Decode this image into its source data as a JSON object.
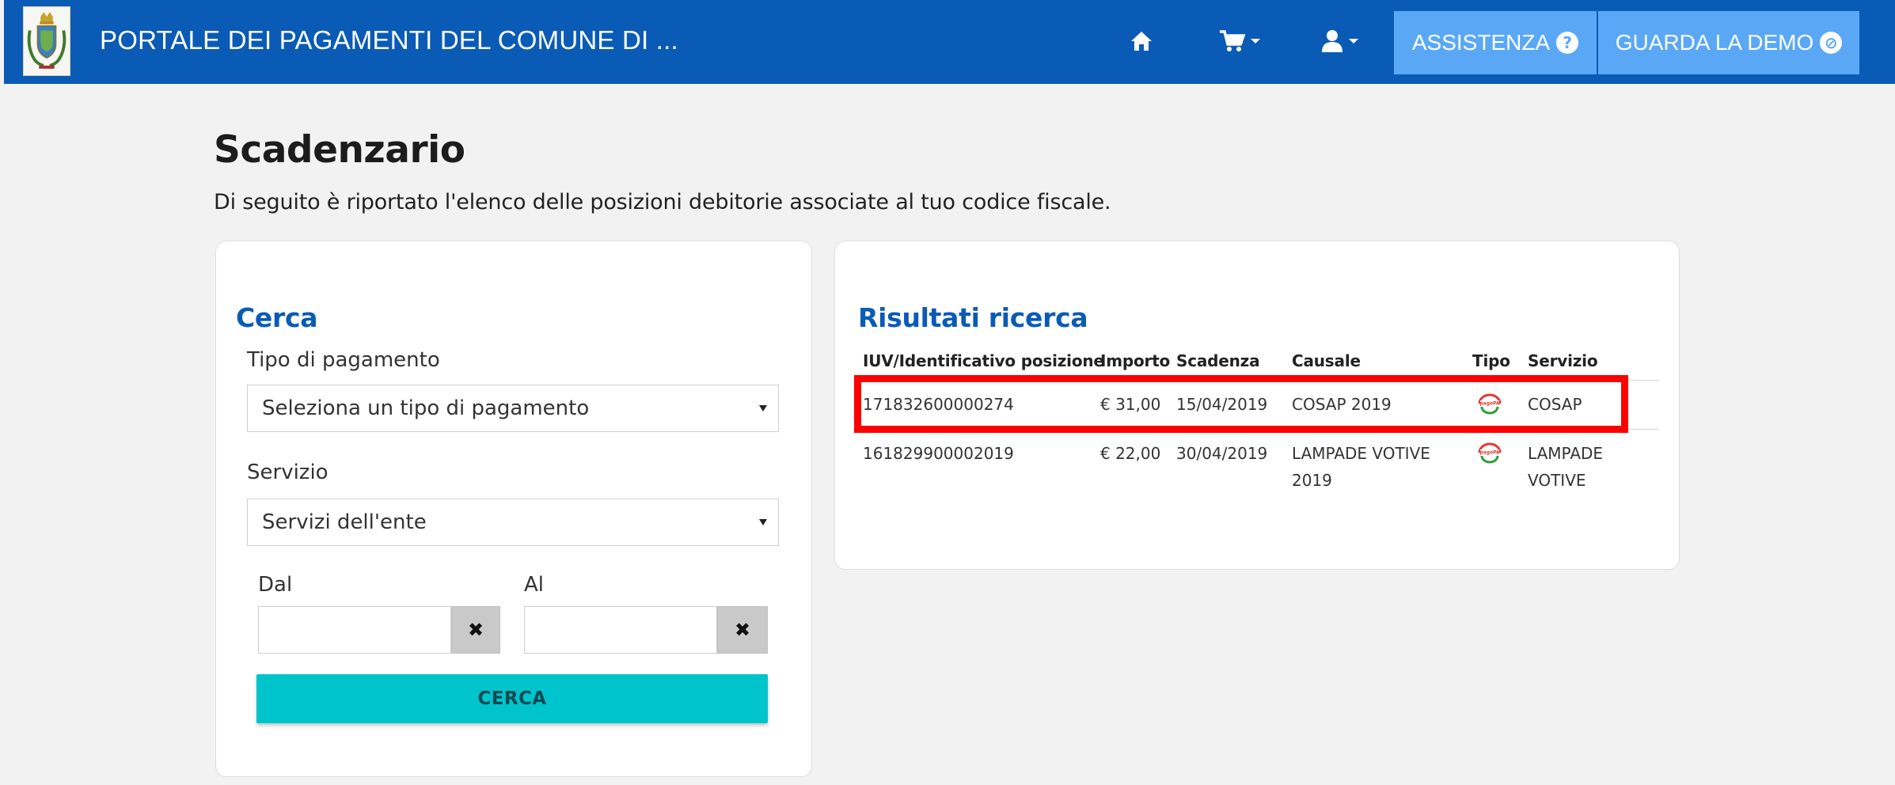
{
  "navbar": {
    "brand": "PORTALE DEI PAGAMENTI DEL COMUNE DI ...",
    "icons": {
      "home": "home-icon",
      "cart": "cart-icon",
      "user": "user-icon"
    },
    "assistenza_label": "ASSISTENZA",
    "assistenza_icon": "?",
    "demo_label": "GUARDA LA DEMO",
    "demo_icon": "⊘",
    "colors": {
      "bar": "#0a5bb5",
      "button": "#5aa8f5"
    }
  },
  "page": {
    "title": "Scadenzario",
    "subtitle": "Di seguito è riportato l'elenco delle posizioni debitorie associate al tuo codice fiscale."
  },
  "search": {
    "heading": "Cerca",
    "tipo_label": "Tipo di pagamento",
    "tipo_value": "Seleziona un tipo di pagamento",
    "servizio_label": "Servizio",
    "servizio_value": "Servizi dell'ente",
    "dal_label": "Dal",
    "al_label": "Al",
    "clear_symbol": "✖",
    "button_label": "CERCA",
    "button_color": "#00c4cc"
  },
  "results": {
    "heading": "Risultati ricerca",
    "columns": [
      "IUV/Identificativo posizione",
      "Importo",
      "Scadenza",
      "Causale",
      "Tipo",
      "Servizio"
    ],
    "rows": [
      {
        "iuv": "171832600000274",
        "importo": "€ 31,00",
        "scadenza": "15/04/2019",
        "causale": "COSAP 2019",
        "causale_l1": "COSAP 2019",
        "causale_l2": "",
        "tipo": "pagopa-icon",
        "servizio_l1": "COSAP",
        "servizio_l2": "",
        "highlighted": true
      },
      {
        "iuv": "161829900002019",
        "importo": "€ 22,00",
        "scadenza": "30/04/2019",
        "causale": "LAMPADE VOTIVE 2019",
        "causale_l1": "LAMPADE VOTIVE",
        "causale_l2": "2019",
        "tipo": "pagopa-icon",
        "servizio_l1": "LAMPADE",
        "servizio_l2": "VOTIVE",
        "highlighted": false
      }
    ],
    "highlight_color": "#ff0000"
  }
}
